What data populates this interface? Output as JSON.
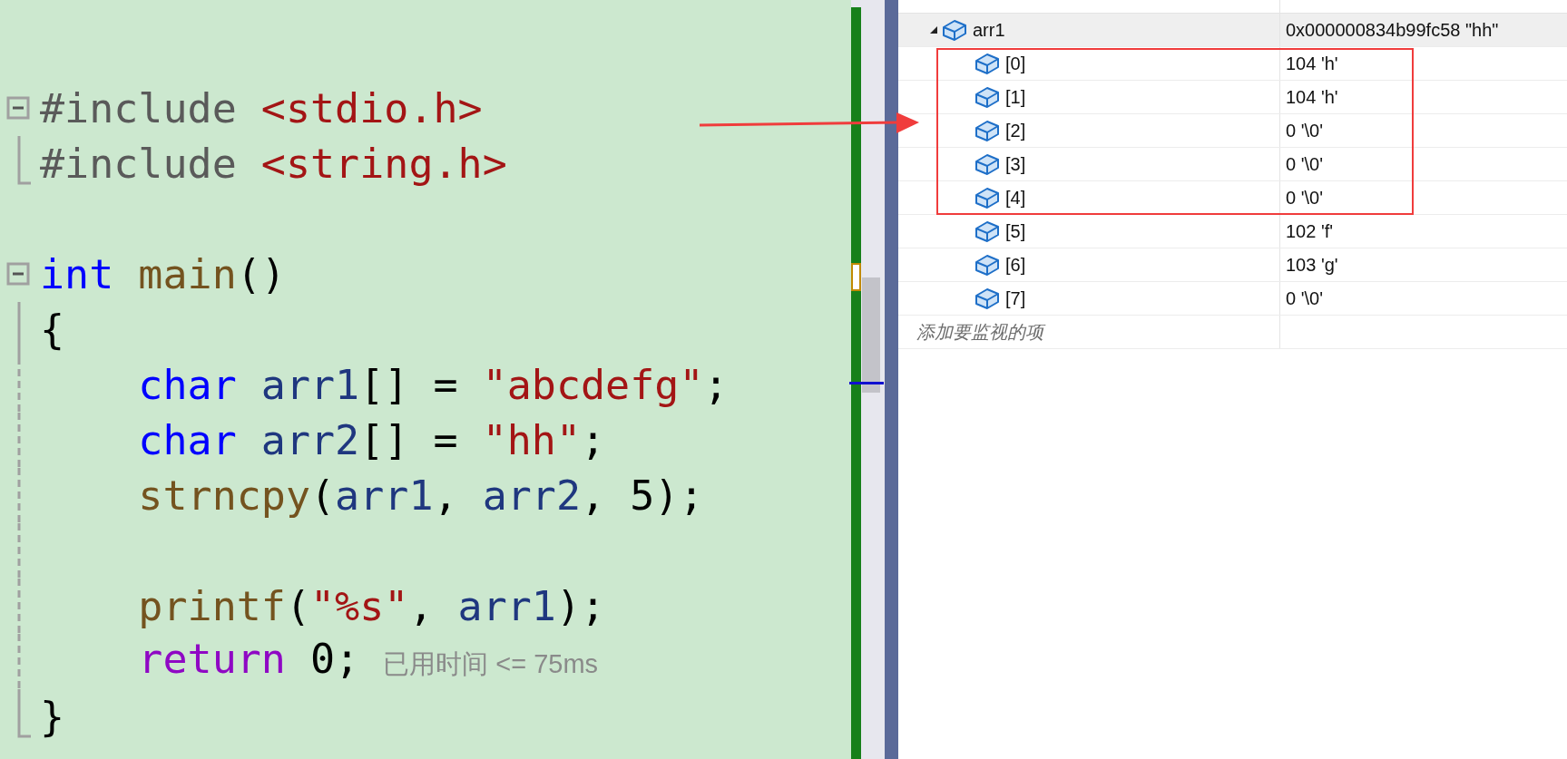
{
  "editor": {
    "lines": [
      {
        "kind": "fold-start",
        "tokens": [
          {
            "text": "#include",
            "kind": "pp"
          },
          {
            "text": "<stdio.h>",
            "kind": "str",
            "gap": true
          }
        ]
      },
      {
        "kind": "fold-end",
        "tokens": [
          {
            "text": "#include",
            "kind": "pp"
          },
          {
            "text": "<string.h>",
            "kind": "str",
            "gap": true
          }
        ]
      },
      {
        "kind": "blank"
      },
      {
        "kind": "fold-start",
        "tokens": [
          {
            "text": "int",
            "kind": "kw"
          },
          {
            "text": "main",
            "kind": "fn",
            "gap": true
          },
          {
            "text": "()",
            "kind": "plain"
          }
        ]
      },
      {
        "kind": "fold-bar",
        "tokens": [
          {
            "text": "{",
            "kind": "plain"
          }
        ]
      },
      {
        "kind": "fold-dashed",
        "indented": true,
        "tokens": [
          {
            "text": "char",
            "kind": "kw"
          },
          {
            "text": "arr1",
            "kind": "var",
            "gap": true
          },
          {
            "text": "[] = ",
            "kind": "plain"
          },
          {
            "text": "\"abcdefg\"",
            "kind": "str"
          },
          {
            "text": ";",
            "kind": "plain"
          }
        ]
      },
      {
        "kind": "fold-dashed",
        "indented": true,
        "tokens": [
          {
            "text": "char",
            "kind": "kw"
          },
          {
            "text": "arr2",
            "kind": "var",
            "gap": true
          },
          {
            "text": "[] = ",
            "kind": "plain"
          },
          {
            "text": "\"hh\"",
            "kind": "str"
          },
          {
            "text": ";",
            "kind": "plain"
          }
        ]
      },
      {
        "kind": "fold-dashed",
        "indented": true,
        "tokens": [
          {
            "text": "strncpy",
            "kind": "fn"
          },
          {
            "text": "(",
            "kind": "plain"
          },
          {
            "text": "arr1",
            "kind": "var"
          },
          {
            "text": ", ",
            "kind": "plain"
          },
          {
            "text": "arr2",
            "kind": "var"
          },
          {
            "text": ", 5);",
            "kind": "plain"
          }
        ]
      },
      {
        "kind": "fold-dashed"
      },
      {
        "kind": "fold-dashed",
        "indented": true,
        "tokens": [
          {
            "text": "printf",
            "kind": "fn"
          },
          {
            "text": "(",
            "kind": "plain"
          },
          {
            "text": "\"%s\"",
            "kind": "str"
          },
          {
            "text": ", ",
            "kind": "plain"
          },
          {
            "text": "arr1",
            "kind": "var"
          },
          {
            "text": ");",
            "kind": "plain"
          }
        ]
      },
      {
        "kind": "fold-dashed",
        "indented": true,
        "tokens": [
          {
            "text": "return",
            "kind": "ctl"
          },
          {
            "text": "0;",
            "kind": "plain",
            "gap": true
          },
          {
            "text": "已用时间 <= 75ms",
            "kind": "hint"
          }
        ]
      },
      {
        "kind": "fold-end",
        "tokens": [
          {
            "text": "}",
            "kind": "plain"
          }
        ]
      }
    ]
  },
  "watch": {
    "items": [
      {
        "name": "arr1",
        "value": "0x000000834b99fc58 \"hh\"",
        "expanded": true,
        "selected": true,
        "children": [
          {
            "name": "[0]",
            "value": "104 'h'",
            "selected": false
          },
          {
            "name": "[1]",
            "value": "104 'h'",
            "selected": false
          },
          {
            "name": "[2]",
            "value": "0 '\\0'",
            "selected": false
          },
          {
            "name": "[3]",
            "value": "0 '\\0'",
            "selected": false
          },
          {
            "name": "[4]",
            "value": "0 '\\0'",
            "selected": false
          },
          {
            "name": "[5]",
            "value": "102 'f'",
            "selected": false
          },
          {
            "name": "[6]",
            "value": "103 'g'",
            "selected": false
          },
          {
            "name": "[7]",
            "value": "0 '\\0'",
            "selected": false
          }
        ]
      }
    ],
    "placeholder": "添加要监视的项"
  }
}
